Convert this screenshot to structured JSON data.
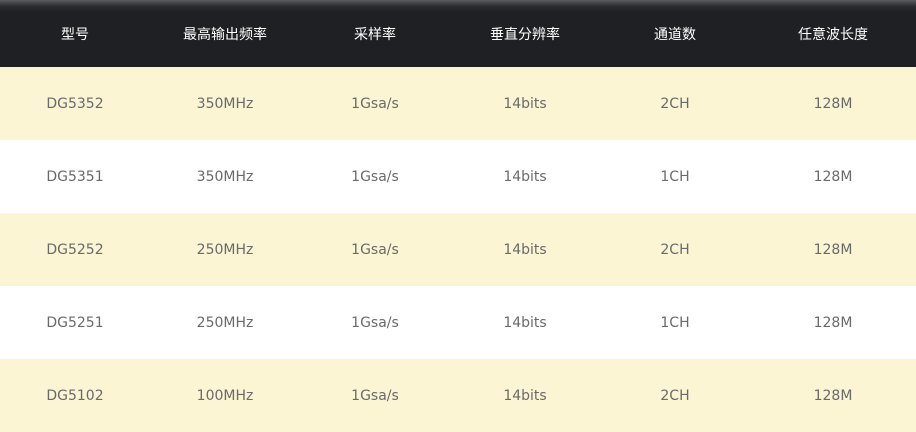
{
  "table": {
    "headers": [
      "型号",
      "最高输出频率",
      "采样率",
      "垂直分辨率",
      "通道数",
      "任意波长度"
    ],
    "rows": [
      [
        "DG5352",
        "350MHz",
        "1Gsa/s",
        "14bits",
        "2CH",
        "128M"
      ],
      [
        "DG5351",
        "350MHz",
        "1Gsa/s",
        "14bits",
        "1CH",
        "128M"
      ],
      [
        "DG5252",
        "250MHz",
        "1Gsa/s",
        "14bits",
        "2CH",
        "128M"
      ],
      [
        "DG5251",
        "250MHz",
        "1Gsa/s",
        "14bits",
        "1CH",
        "128M"
      ],
      [
        "DG5102",
        "100MHz",
        "1Gsa/s",
        "14bits",
        "2CH",
        "128M"
      ]
    ]
  },
  "colors": {
    "header_background": "#1f2023",
    "header_text": "#ffffff",
    "stripe_background": "#fbf5d4",
    "plain_background": "#ffffff",
    "body_text": "#6a6a6a"
  }
}
